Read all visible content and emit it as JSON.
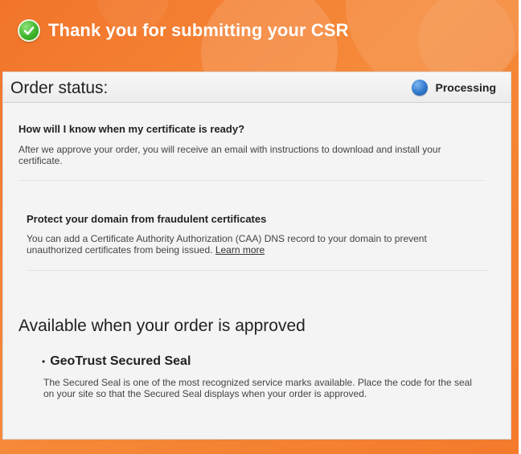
{
  "header": {
    "title": "Thank you for submitting your CSR",
    "icon": "check-circle-icon"
  },
  "status": {
    "label": "Order status:",
    "value": "Processing",
    "indicator_color": "#2f78cc",
    "indicator_icon": "status-dot-icon"
  },
  "certificate_ready": {
    "heading": "How will I know when my certificate is ready?",
    "line1": "After we approve your order, you will receive an email with instructions to download and install your",
    "line2": "certificate."
  },
  "caa": {
    "heading": "Protect your domain from fraudulent certificates",
    "line1": "You can add a Certificate Authority Authorization (CAA) DNS record to your domain to prevent",
    "line2": "unauthorized certificates from being issued.",
    "link": "Learn more"
  },
  "available": {
    "title": "Available when your order is approved",
    "item_title": "GeoTrust Secured Seal",
    "bullet": "•",
    "line1": "The Secured Seal is one of the most recognized service marks available. Place the code for the seal",
    "line2": "on your site so that the Secured Seal displays when your order is approved."
  },
  "colors": {
    "accent": "#f47a2c",
    "success": "#3fb52b"
  }
}
